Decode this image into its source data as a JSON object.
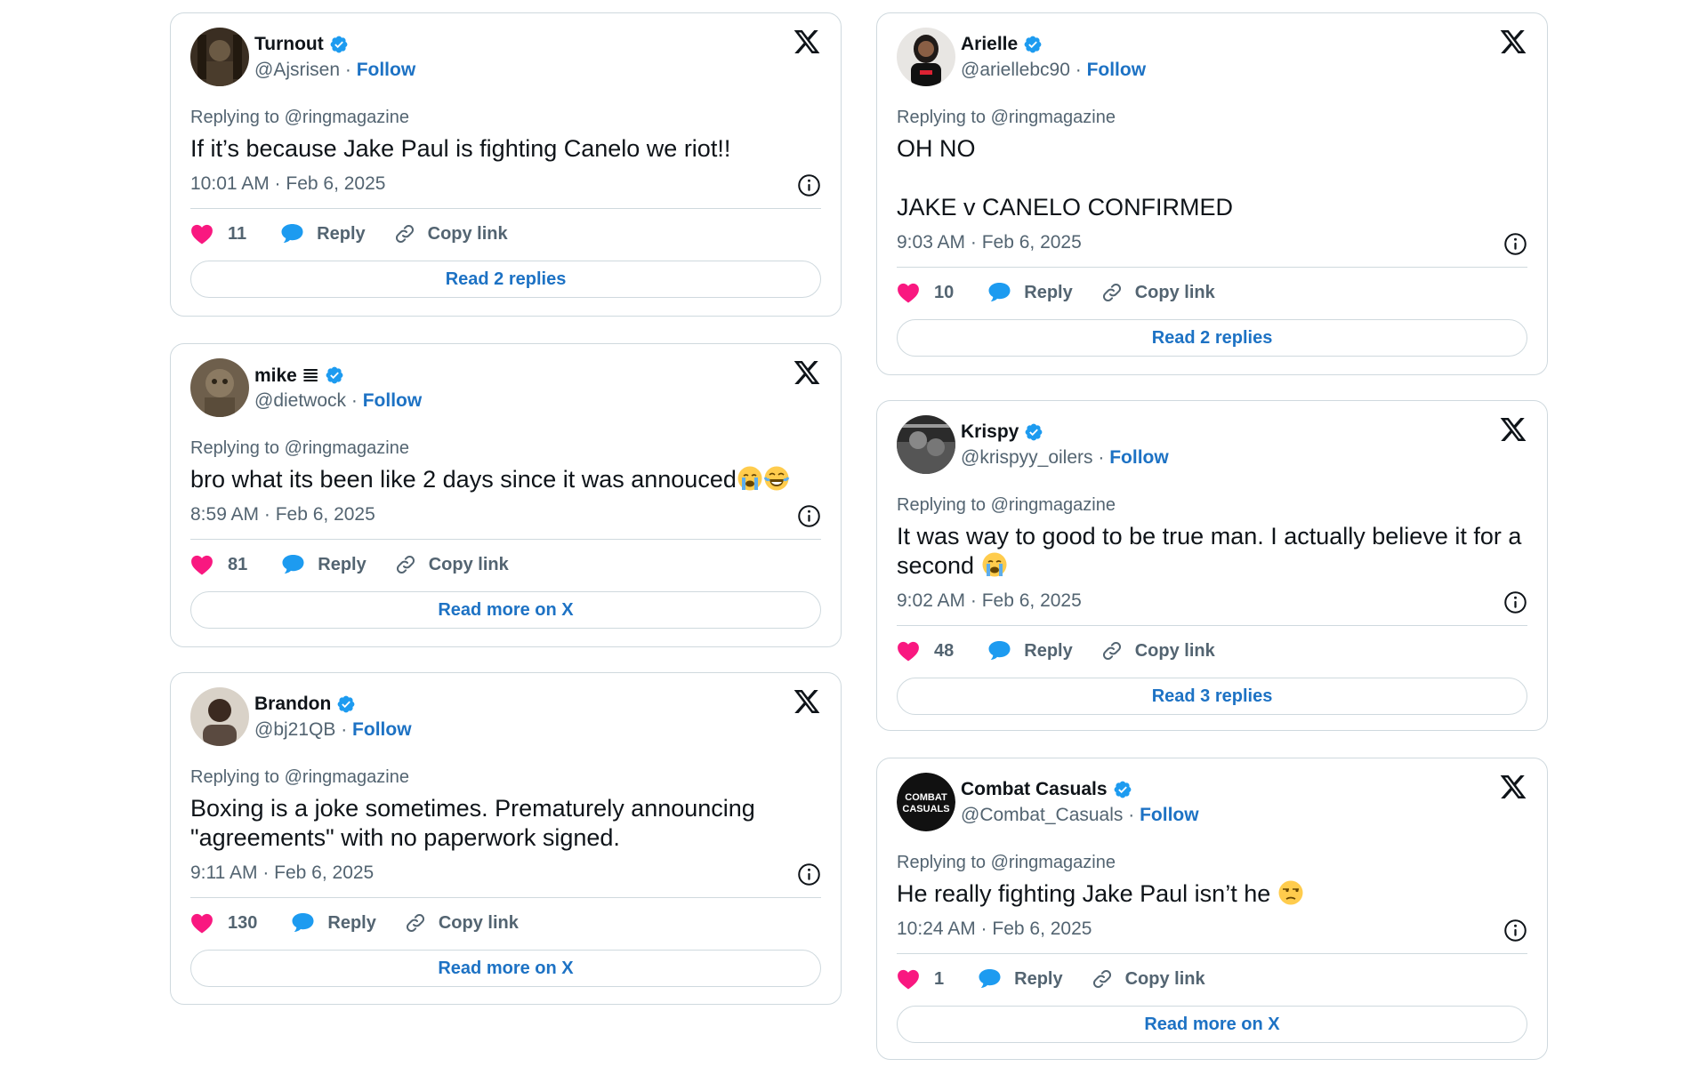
{
  "tweets": [
    {
      "name": "Turnout",
      "handle": "@Ajsrisen",
      "follow": "Follow",
      "replying": "Replying to @ringmagazine",
      "text": "If it’s because Jake Paul is fighting Canelo we riot!!",
      "meta": "10:01 AM · Feb 6, 2025",
      "likes": "11",
      "reply": "Reply",
      "copy": "Copy link",
      "button": "Read 2 replies"
    },
    {
      "name": "mike 𝌆",
      "handle": "@dietwock",
      "follow": "Follow",
      "replying": "Replying to @ringmagazine",
      "text": "bro what its been like 2 days since it was annouced",
      "meta": "8:59 AM · Feb 6, 2025",
      "likes": "81",
      "reply": "Reply",
      "copy": "Copy link",
      "button": "Read more on X"
    },
    {
      "name": "Brandon",
      "handle": "@bj21QB",
      "follow": "Follow",
      "replying": "Replying to @ringmagazine",
      "text": "Boxing is a joke sometimes.  Prematurely announcing \"agreements\" with no paperwork signed.",
      "meta": "9:11 AM · Feb 6, 2025",
      "likes": "130",
      "reply": "Reply",
      "copy": "Copy link",
      "button": "Read more on X"
    },
    {
      "name": "Arielle",
      "handle": "@ariellebc90",
      "follow": "Follow",
      "replying": "Replying to @ringmagazine",
      "text": "OH NO\n\nJAKE v CANELO CONFIRMED",
      "meta": "9:03 AM · Feb 6, 2025",
      "likes": "10",
      "reply": "Reply",
      "copy": "Copy link",
      "button": "Read 2 replies"
    },
    {
      "name": "Krispy",
      "handle": "@krispyy_oilers",
      "follow": "Follow",
      "replying": "Replying to @ringmagazine",
      "text": "It was way to good to be true man. I actually believe it for a second",
      "meta": "9:02 AM · Feb 6, 2025",
      "likes": "48",
      "reply": "Reply",
      "copy": "Copy link",
      "button": "Read 3 replies"
    },
    {
      "name": "Combat Casuals",
      "handle": "@Combat_Casuals",
      "follow": "Follow",
      "replying": "Replying to @ringmagazine",
      "text": "He really fighting Jake Paul isn’t he",
      "meta": "10:24 AM · Feb 6, 2025",
      "likes": "1",
      "reply": "Reply",
      "copy": "Copy link",
      "button": "Read more on X",
      "avatar_text": "COMBAT CASUALS"
    }
  ],
  "colors": {
    "like": "#f91880",
    "reply": "#1d9bf0",
    "verified": "#1d9bf0",
    "link": "#1d72c4",
    "muted": "#536471",
    "border": "#cfd9de"
  }
}
